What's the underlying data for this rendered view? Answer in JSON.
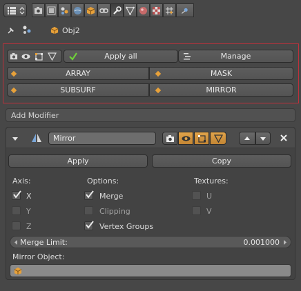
{
  "context": {
    "object_name": "Obj2"
  },
  "header_tabs": [
    "render-icon",
    "render-layers-icon",
    "scene-icon",
    "world-icon",
    "object-icon",
    "constraints-icon",
    "modifiers-icon",
    "data-icon",
    "material-icon",
    "texture-icon",
    "particles-icon",
    "physics-icon"
  ],
  "batch": {
    "apply_all": "Apply all",
    "manage": "Manage",
    "modifiers": [
      "ARRAY",
      "MASK",
      "SUBSURF",
      "MIRROR"
    ]
  },
  "add_modifier": "Add Modifier",
  "modifier": {
    "name": "Mirror",
    "apply": "Apply",
    "copy": "Copy",
    "axis_label": "Axis:",
    "options_label": "Options:",
    "textures_label": "Textures:",
    "axis": [
      {
        "label": "X",
        "checked": true
      },
      {
        "label": "Y",
        "checked": false
      },
      {
        "label": "Z",
        "checked": false
      }
    ],
    "options": [
      {
        "label": "Merge",
        "checked": true
      },
      {
        "label": "Clipping",
        "checked": false
      },
      {
        "label": "Vertex Groups",
        "checked": true
      }
    ],
    "textures": [
      {
        "label": "U",
        "checked": false
      },
      {
        "label": "V",
        "checked": false
      }
    ],
    "merge_limit_label": "Merge Limit:",
    "merge_limit_value": "0.001000",
    "mirror_object_label": "Mirror Object:"
  },
  "colors": {
    "accent": "#e7a13a",
    "highlight_box": "#c0303b",
    "check": "#e8e8e8"
  }
}
